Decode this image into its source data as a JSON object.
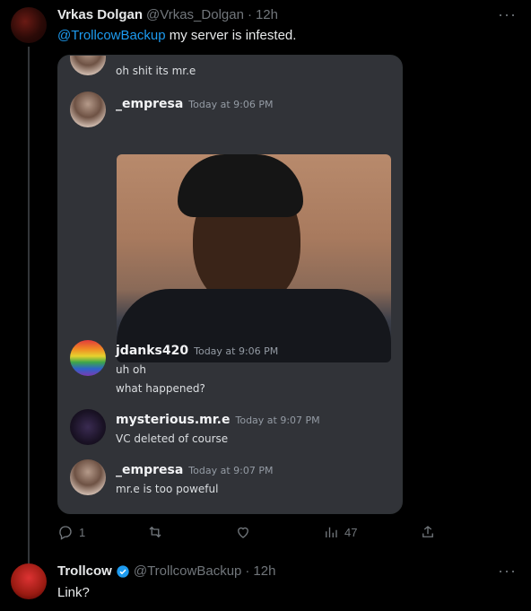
{
  "tweet1": {
    "name": "Vrkas Dolgan",
    "handle": "@Vrkas_Dolgan",
    "separator": "·",
    "time": "12h",
    "mention": "@TrollcowBackup",
    "text": " my server is infested.",
    "more_icon": "more-icon",
    "actions": {
      "reply_count": "1",
      "retweet_count": "",
      "like_count": "",
      "views_count": "47"
    }
  },
  "embed": {
    "top_partial": {
      "line": "oh shit its mr.e"
    },
    "messages": [
      {
        "user": "_empresa",
        "time": "Today at 9:06 PM",
        "lines": []
      },
      {
        "user": "jdanks420",
        "time": "Today at 9:06 PM",
        "lines": [
          "uh oh",
          "what happened?"
        ]
      },
      {
        "user": "mysterious.mr.e",
        "time": "Today at 9:07 PM",
        "lines": [
          "VC deleted of course"
        ]
      },
      {
        "user": "_empresa",
        "time": "Today at 9:07 PM",
        "lines": [
          "mr.e is too poweful"
        ]
      }
    ]
  },
  "tweet2": {
    "name": "Trollcow",
    "handle": "@TrollcowBackup",
    "separator": "·",
    "time": "12h",
    "text": "Link?",
    "verified_color": "#1d9bf0"
  },
  "colors": {
    "accent": "#1d9bf0",
    "muted": "#71767b",
    "discord_bg": "#313338"
  }
}
